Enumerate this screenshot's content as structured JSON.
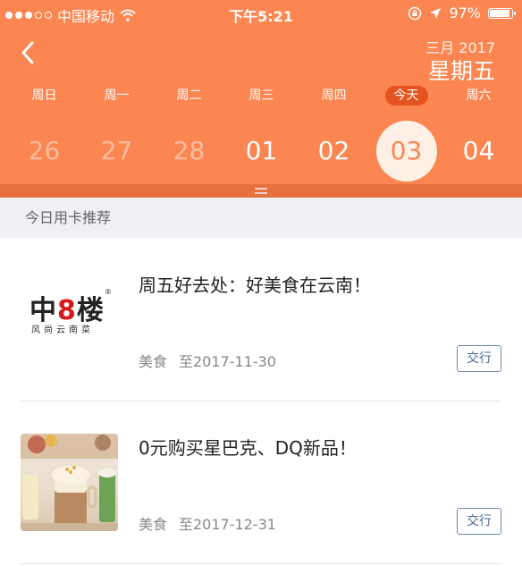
{
  "status_bar": {
    "carrier": "中国移动",
    "time": "下午5:21",
    "battery": "97%",
    "battery_level": 0.97,
    "signal_bars": 3
  },
  "header": {
    "month_label": "三月 2017",
    "weekday_label": "星期五",
    "accent_color": "#fc8651"
  },
  "calendar": {
    "weekdays": [
      "周日",
      "周一",
      "周二",
      "周三",
      "周四",
      "今天",
      "周六"
    ],
    "dates": [
      "26",
      "27",
      "28",
      "01",
      "02",
      "03",
      "04"
    ],
    "today_index": 5,
    "selected_index": 5
  },
  "section": {
    "title": "今日用卡推荐"
  },
  "cards": [
    {
      "title": "周五好去处：好美食在云南！",
      "category": "美食",
      "expiry": "至2017-11-30",
      "button": "交行",
      "logo_main": "中8楼",
      "logo_eight": "8",
      "logo_sub": "风尚云南菜",
      "logo_reg": "®"
    },
    {
      "title": "0元购买星巴克、DQ新品！",
      "category": "美食",
      "expiry": "至2017-12-31",
      "button": "交行"
    }
  ]
}
